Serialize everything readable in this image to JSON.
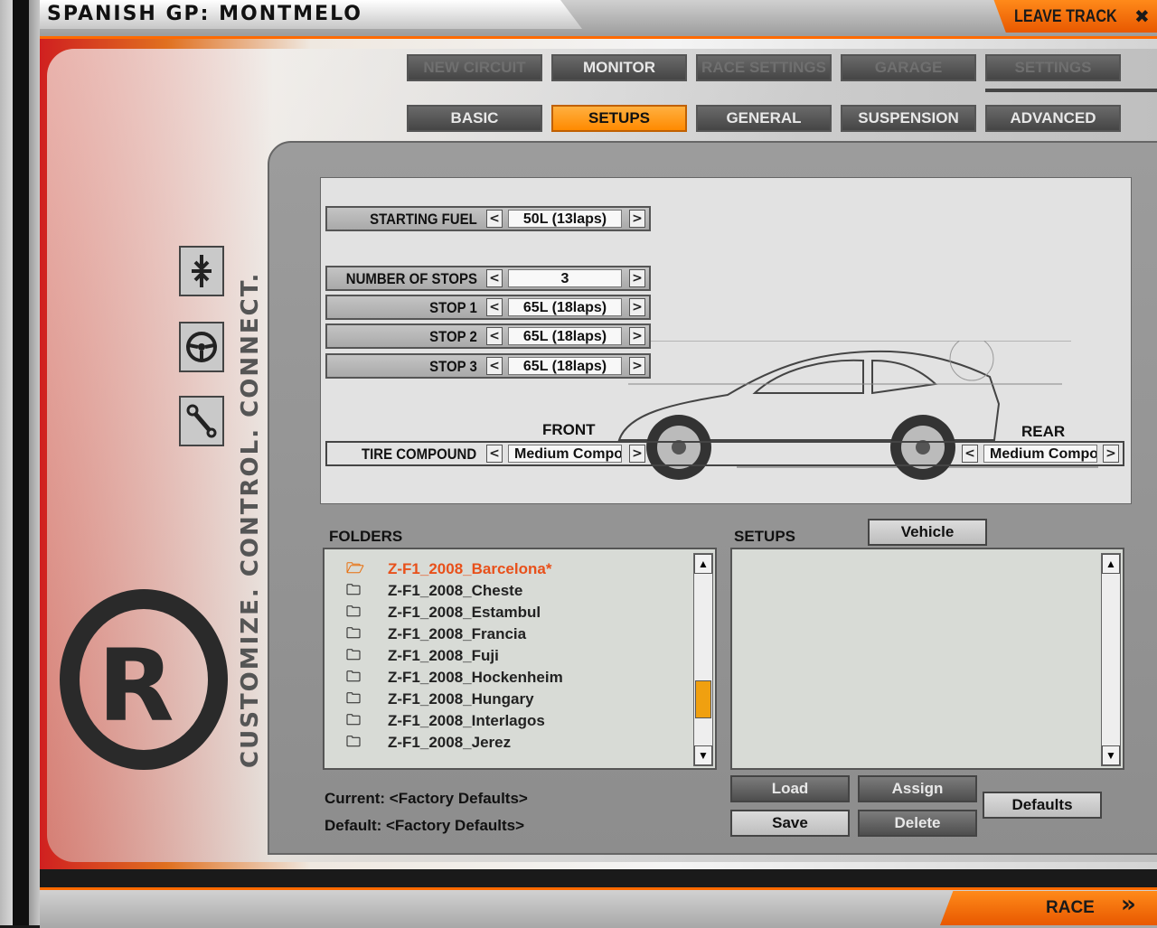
{
  "header": {
    "title": "SPANISH GP: MONTMELO",
    "leave_track": "LEAVE TRACK",
    "close_glyph": "✖"
  },
  "brand": {
    "slogan": "CUSTOMIZE. CONTROL. CONNECT.",
    "logo_letter": "R"
  },
  "top_tabs": [
    "NEW CIRCUIT",
    "MONITOR",
    "RACE SETTINGS",
    "GARAGE",
    "SETTINGS"
  ],
  "sub_tabs": [
    "BASIC",
    "SETUPS",
    "GENERAL",
    "SUSPENSION",
    "ADVANCED"
  ],
  "strategy": {
    "starting_fuel": {
      "label": "STARTING FUEL",
      "value": "50L (13laps)"
    },
    "number_of_stops": {
      "label": "NUMBER OF STOPS",
      "value": "3"
    },
    "stops": [
      {
        "label": "STOP 1",
        "value": "65L (18laps)"
      },
      {
        "label": "STOP 2",
        "value": "65L (18laps)"
      },
      {
        "label": "STOP 3",
        "value": "65L (18laps)"
      }
    ],
    "tire": {
      "label": "TIRE COMPOUND",
      "front_label": "FRONT",
      "rear_label": "REAR",
      "front_value": "Medium Compound",
      "rear_value": "Medium Compound"
    }
  },
  "folders": {
    "label": "FOLDERS",
    "items": [
      "Z-F1_2008_Barcelona*",
      "Z-F1_2008_Cheste",
      "Z-F1_2008_Estambul",
      "Z-F1_2008_Francia",
      "Z-F1_2008_Fuji",
      "Z-F1_2008_Hockenheim",
      "Z-F1_2008_Hungary",
      "Z-F1_2008_Interlagos",
      "Z-F1_2008_Jerez"
    ]
  },
  "setups": {
    "label": "SETUPS",
    "vehicle_button": "Vehicle"
  },
  "buttons": {
    "load": "Load",
    "assign": "Assign",
    "save": "Save",
    "delete": "Delete",
    "defaults": "Defaults"
  },
  "info": {
    "current": "Current:  <Factory Defaults>",
    "default": "Default:  <Factory Defaults>"
  },
  "footer": {
    "race": "RACE"
  },
  "colors": {
    "accent": "#ff8a00",
    "selected_folder": "#e8501a"
  }
}
